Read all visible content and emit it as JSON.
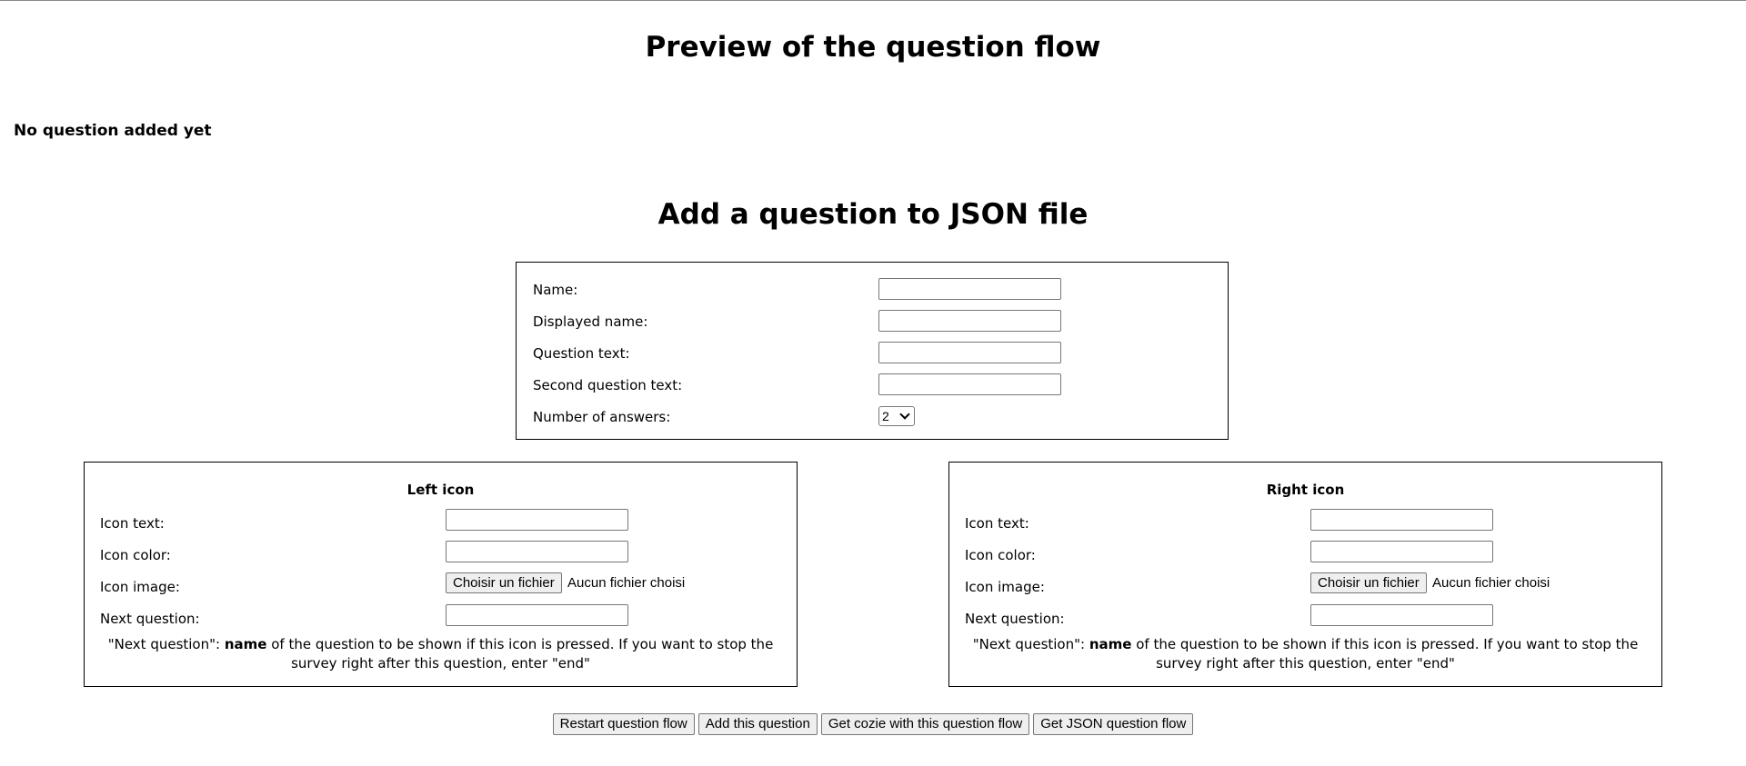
{
  "preview": {
    "title": "Preview of the question flow",
    "empty_message": "No question added yet"
  },
  "form": {
    "title": "Add a question to JSON file",
    "fields": {
      "name_label": "Name:",
      "name_value": "",
      "displayed_name_label": "Displayed name:",
      "displayed_name_value": "",
      "question_text_label": "Question text:",
      "question_text_value": "",
      "second_question_text_label": "Second question text:",
      "second_question_text_value": "",
      "number_of_answers_label": "Number of answers:",
      "number_of_answers_value": "2"
    }
  },
  "left_icon": {
    "heading": "Left icon",
    "icon_text_label": "Icon text:",
    "icon_text_value": "",
    "icon_color_label": "Icon color:",
    "icon_color_value": "",
    "icon_image_label": "Icon image:",
    "file_button_label": "Choisir un fichier",
    "file_status": "Aucun fichier choisi",
    "next_question_label": "Next question:",
    "next_question_value": "",
    "help_prefix": "\"Next question\": ",
    "help_bold": "name",
    "help_suffix": " of the question to be shown if this icon is pressed. If you want to stop the survey right after this question, enter \"end\""
  },
  "right_icon": {
    "heading": "Right icon",
    "icon_text_label": "Icon text:",
    "icon_text_value": "",
    "icon_color_label": "Icon color:",
    "icon_color_value": "",
    "icon_image_label": "Icon image:",
    "file_button_label": "Choisir un fichier",
    "file_status": "Aucun fichier choisi",
    "next_question_label": "Next question:",
    "next_question_value": "",
    "help_prefix": "\"Next question\": ",
    "help_bold": "name",
    "help_suffix": " of the question to be shown if this icon is pressed. If you want to stop the survey right after this question, enter \"end\""
  },
  "actions": {
    "restart_label": "Restart question flow",
    "add_label": "Add this question",
    "get_cozie_label": "Get cozie with this question flow",
    "get_json_label": "Get JSON question flow"
  }
}
